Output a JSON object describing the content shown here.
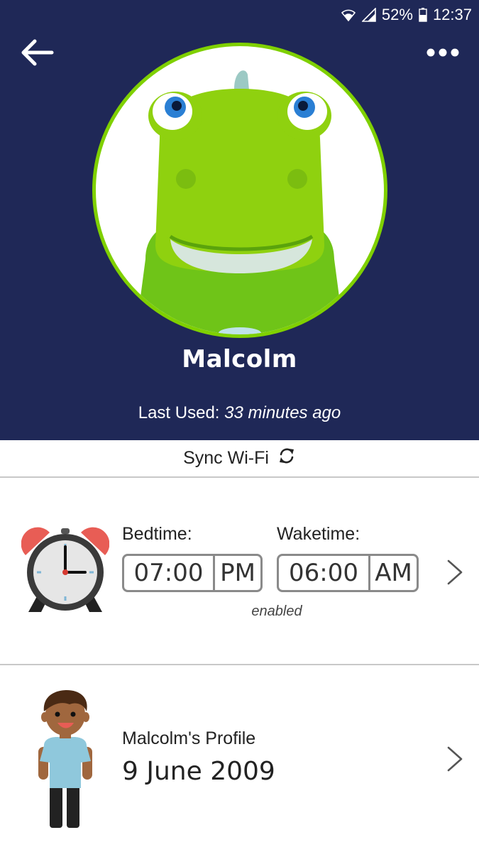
{
  "status_bar": {
    "battery": "52%",
    "time": "12:37",
    "icons": [
      "wifi-icon",
      "signal-icon",
      "battery-icon"
    ]
  },
  "header": {
    "back_icon": "arrow-left-icon",
    "menu_icon": "more-horizontal-icon",
    "robot_name": "Malcolm",
    "last_used_label": "Last Used:",
    "last_used_value": "33 minutes ago"
  },
  "sync": {
    "label": "Sync Wi-Fi",
    "icon": "sync-icon"
  },
  "alarm": {
    "icon": "alarm-clock-icon",
    "bedtime_label": "Bedtime:",
    "bedtime_time": "07:00",
    "bedtime_period": "PM",
    "waketime_label": "Waketime:",
    "waketime_time": "06:00",
    "waketime_period": "AM",
    "status": "enabled"
  },
  "profile": {
    "icon": "child-avatar-icon",
    "name": "Malcolm's Profile",
    "birthdate": "9 June 2009"
  },
  "colors": {
    "header_bg": "#1f2857",
    "ring": "#7fd000",
    "divider": "#c8c8c8"
  }
}
